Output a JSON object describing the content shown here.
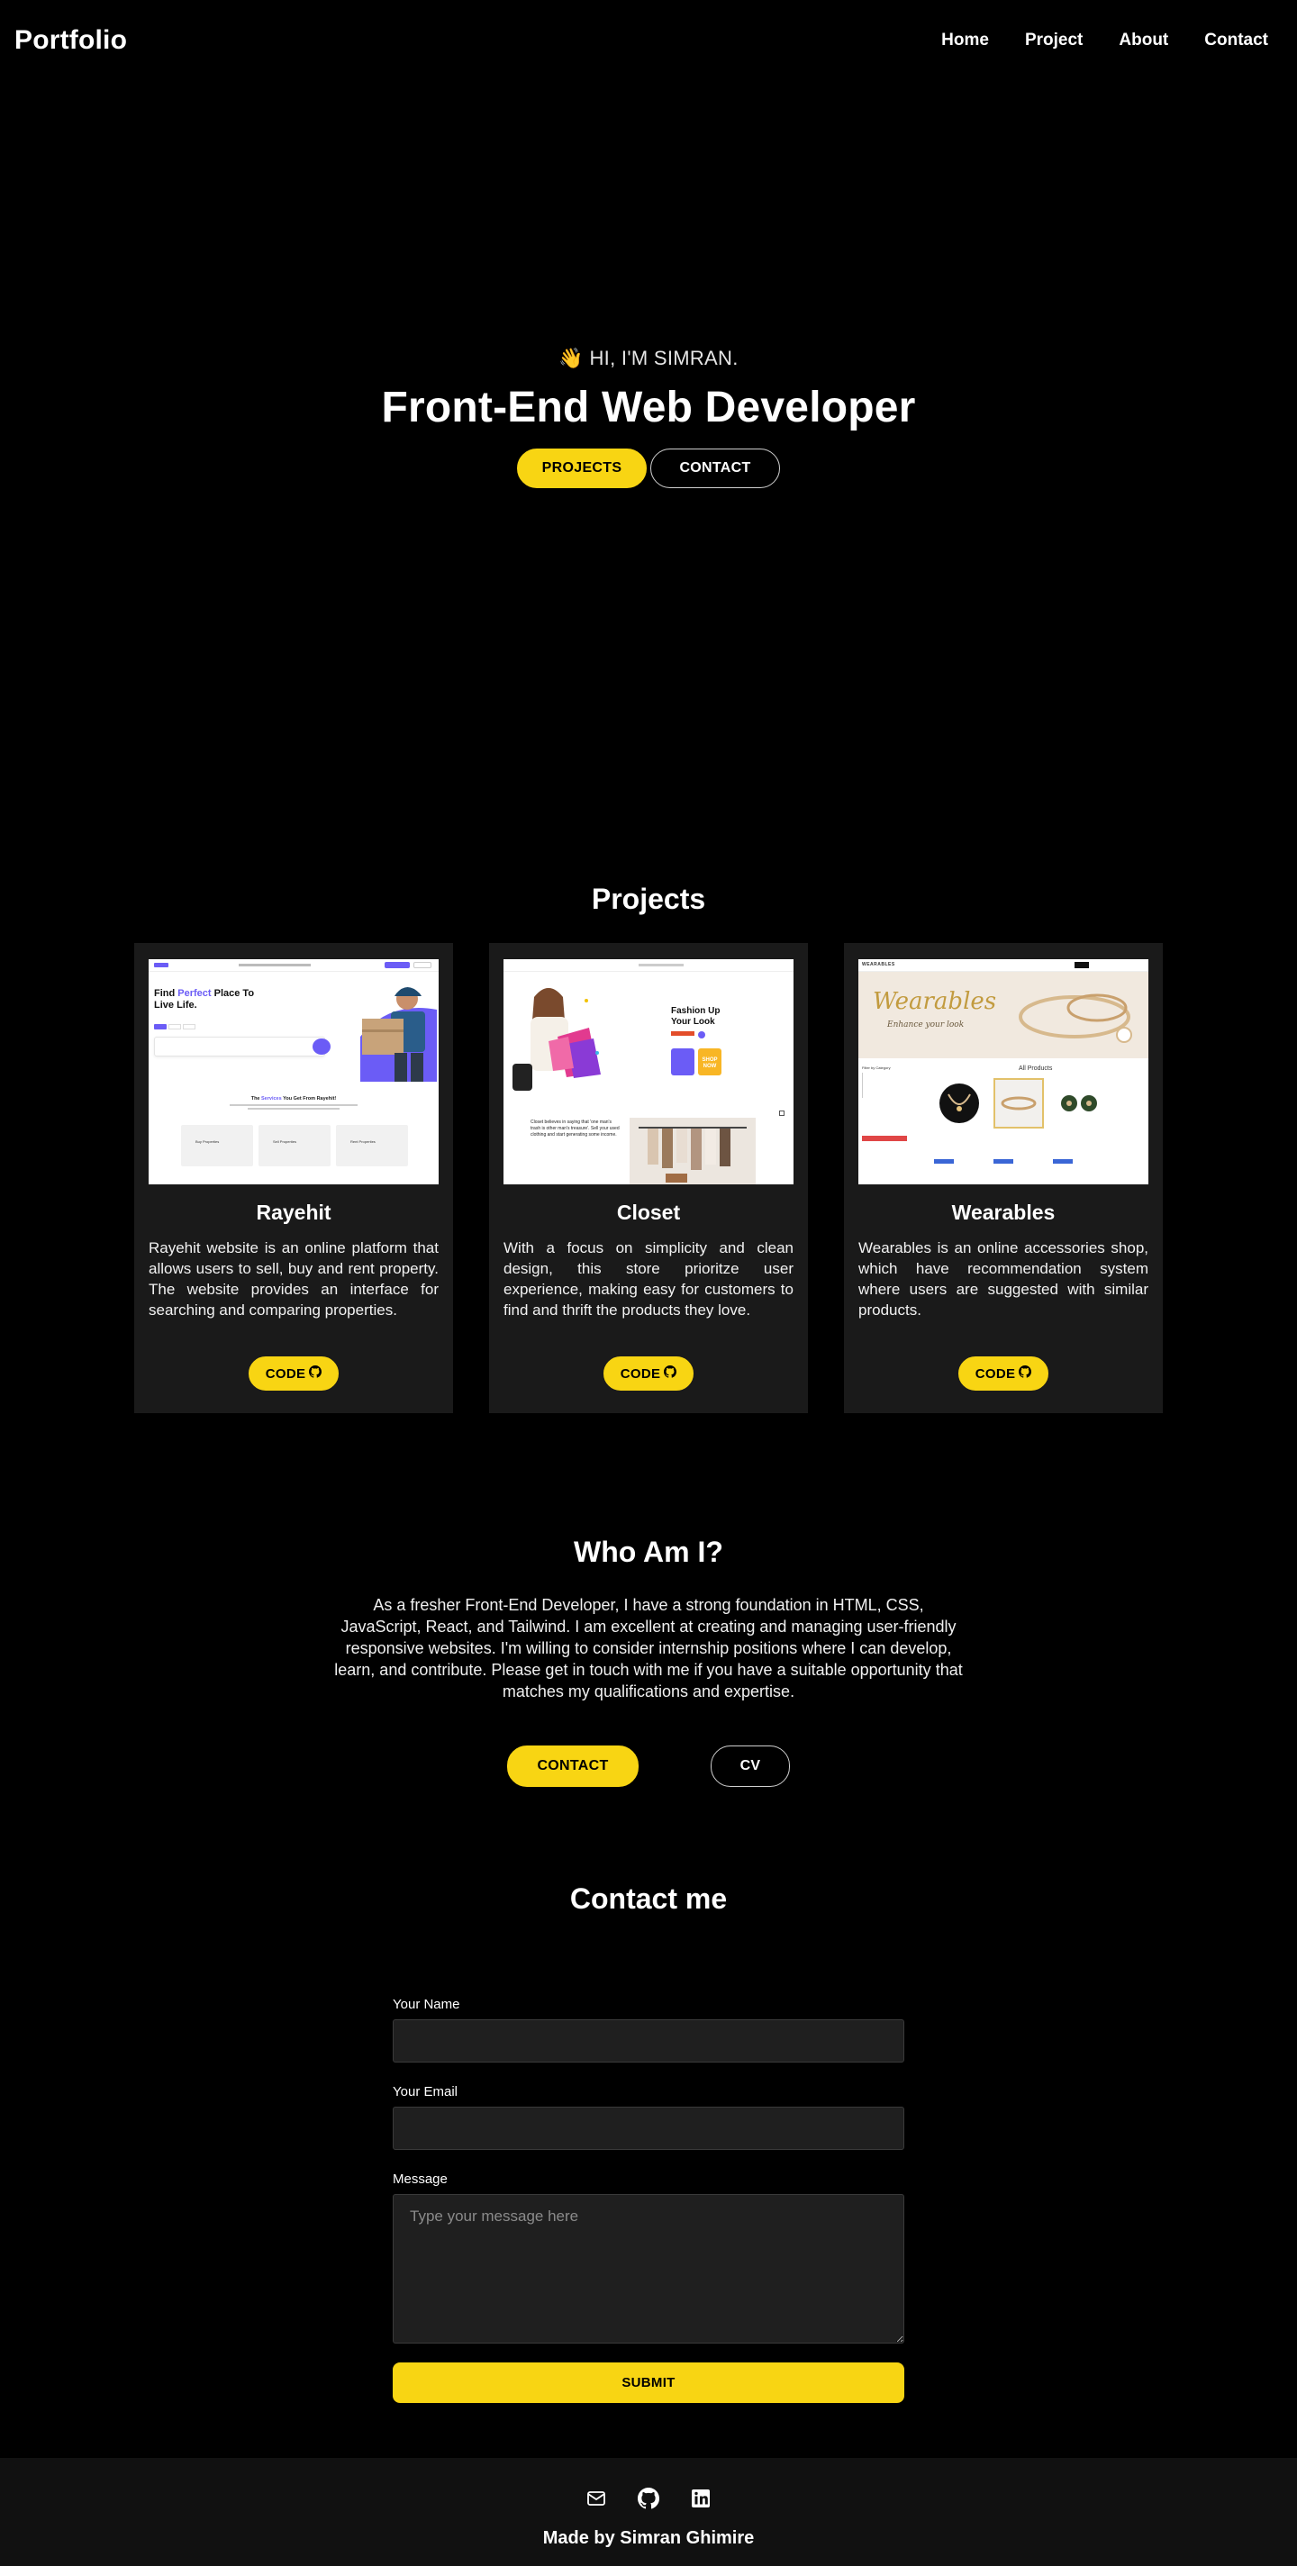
{
  "nav": {
    "logo": "Portfolio",
    "links": [
      "Home",
      "Project",
      "About",
      "Contact"
    ]
  },
  "hero": {
    "wave_icon": "waving-hand-icon",
    "greeting_emoji": "👋",
    "greeting": "HI, I'M SIMRAN.",
    "title": "Front-End Web Developer",
    "projects_button": "PROJECTS",
    "contact_button": "CONTACT"
  },
  "projects": {
    "title": "Projects",
    "items": [
      {
        "name": "Rayehit",
        "description": "Rayehit website is an online platform that allows users to sell, buy and rent property. The website provides an interface for searching and comparing properties.",
        "button": "CODE",
        "thumb": {
          "headline_a": "Find ",
          "headline_accent": "Perfect",
          "headline_b": " Place To Live Life.",
          "subheading_a": "The ",
          "subheading_accent": "Services",
          "subheading_b": " You Get From Rayehit!",
          "services": [
            "Buy Properties",
            "Sell Properties",
            "Rent Properties"
          ]
        }
      },
      {
        "name": "Closet",
        "description": "With a focus on simplicity and clean design, this store prioritze user experience, making easy for customers to find and thrift the products they love.",
        "button": "CODE",
        "thumb": {
          "headline_a": "Fashion Up",
          "headline_b": "Your Look",
          "shop_label": "SHOP NOW",
          "about": "Closet believes in saying that 'one man's trash is other man's treasure'. Sell your used clothing and start generating some income."
        }
      },
      {
        "name": "Wearables",
        "description": "Wearables is an online accessories shop, which have recommendation system where users are suggested with similar products.",
        "button": "CODE",
        "thumb": {
          "brand": "WEARABLES",
          "banner_title": "Wearables",
          "banner_sub": "Enhance your look",
          "filter_title": "Filter by Category",
          "products_title": "All Products"
        }
      }
    ],
    "code_icon": "github-icon"
  },
  "who": {
    "title": "Who Am I?",
    "text": "As a fresher Front-End Developer, I have a strong foundation in HTML, CSS, JavaScript, React, and Tailwind. I am excellent at creating and managing user-friendly responsive websites. I'm willing to consider internship positions where I can develop, learn, and contribute. Please get in touch with me if you have a suitable opportunity that matches my qualifications and expertise.",
    "contact_button": "CONTACT",
    "cv_button": "CV"
  },
  "contact": {
    "title": "Contact me",
    "name_label": "Your Name",
    "name_value": "",
    "email_label": "Your Email",
    "email_value": "",
    "message_label": "Message",
    "message_placeholder": "Type your message here",
    "submit": "SUBMIT"
  },
  "footer": {
    "icons": [
      "mail-icon",
      "github-icon",
      "linkedin-icon"
    ],
    "text": "Made by Simran Ghimire"
  },
  "colors": {
    "accent": "#f8d513",
    "background": "#000000",
    "card": "#1a1a1a",
    "footer": "#111111"
  }
}
